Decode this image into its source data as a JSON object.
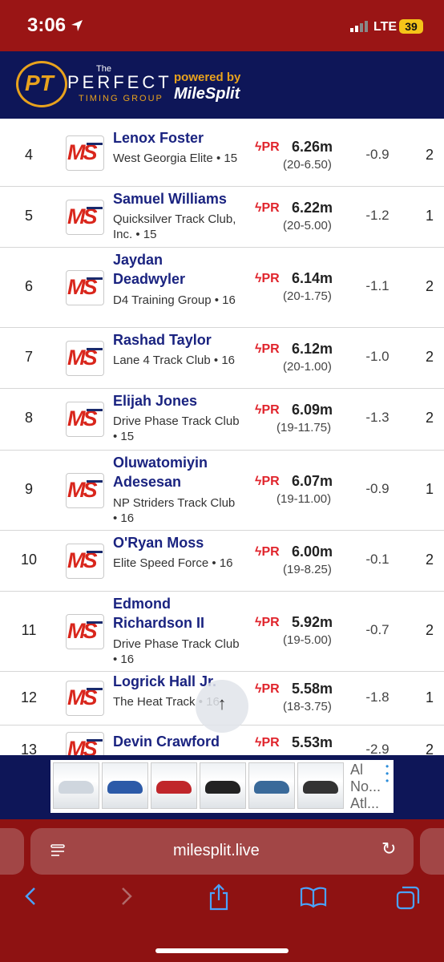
{
  "status_bar": {
    "time": "3:06",
    "network": "LTE",
    "battery": "39"
  },
  "header": {
    "logo_text": "PT",
    "logo_the": "The",
    "logo_perfect": "PERFECT",
    "logo_timing": "TIMING GROUP",
    "powered_by": "powered by",
    "milesplit": "MileSplit"
  },
  "results": {
    "rows": [
      {
        "place": "4",
        "name": "Lenox Foster",
        "team": "West Georgia Elite • 15",
        "pr": "PR",
        "mark": "6.26m",
        "imperial": "(20-6.50)",
        "wind": "-0.9",
        "heat": "2"
      },
      {
        "place": "5",
        "name": "Samuel Williams",
        "team": "Quicksilver Track Club, Inc. • 15",
        "pr": "PR",
        "mark": "6.22m",
        "imperial": "(20-5.00)",
        "wind": "-1.2",
        "heat": "1"
      },
      {
        "place": "6",
        "name": "Jaydan Deadwyler",
        "team": "D4 Training Group • 16",
        "pr": "PR",
        "mark": "6.14m",
        "imperial": "(20-1.75)",
        "wind": "-1.1",
        "heat": "2"
      },
      {
        "place": "7",
        "name": "Rashad Taylor",
        "team": "Lane 4 Track Club • 16",
        "pr": "PR",
        "mark": "6.12m",
        "imperial": "(20-1.00)",
        "wind": "-1.0",
        "heat": "2"
      },
      {
        "place": "8",
        "name": "Elijah Jones",
        "team": "Drive Phase Track Club • 15",
        "pr": "PR",
        "mark": "6.09m",
        "imperial": "(19-11.75)",
        "wind": "-1.3",
        "heat": "2"
      },
      {
        "place": "9",
        "name": "Oluwatomiyin Adesesan",
        "team": "NP Striders Track Club • 16",
        "pr": "PR",
        "mark": "6.07m",
        "imperial": "(19-11.00)",
        "wind": "-0.9",
        "heat": "1"
      },
      {
        "place": "10",
        "name": "O'Ryan Moss",
        "team": "Elite Speed Force • 16",
        "pr": "PR",
        "mark": "6.00m",
        "imperial": "(19-8.25)",
        "wind": "-0.1",
        "heat": "2"
      },
      {
        "place": "11",
        "name": "Edmond Richardson II",
        "team": "Drive Phase Track Club • 16",
        "pr": "PR",
        "mark": "5.92m",
        "imperial": "(19-5.00)",
        "wind": "-0.7",
        "heat": "2"
      },
      {
        "place": "12",
        "name": "Logrick Hall Jr.",
        "team": "The Heat Track • 16",
        "pr": "PR",
        "mark": "5.58m",
        "imperial": "(18-3.75)",
        "wind": "-1.8",
        "heat": "1"
      },
      {
        "place": "13",
        "name": "Devin Crawford",
        "team": "",
        "pr": "PR",
        "mark": "5.53m",
        "imperial": "",
        "wind": "-2.9",
        "heat": "2"
      }
    ]
  },
  "ad": {
    "text_line1": "Al",
    "text_line2": "No...",
    "text_line3": "Atl..."
  },
  "browser": {
    "url": "milesplit.live"
  }
}
